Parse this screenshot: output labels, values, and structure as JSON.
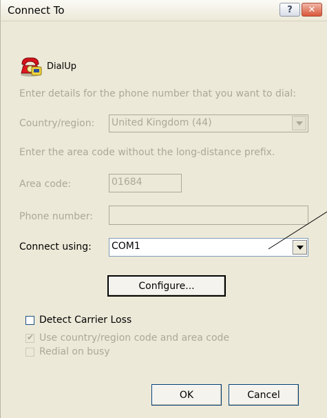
{
  "window": {
    "title": "Connect To",
    "help_glyph": "?",
    "close_glyph": "✕"
  },
  "connection": {
    "name": "DialUp",
    "icon": "phone-icon"
  },
  "instructions": {
    "phone": "Enter details for the phone number that you want to dial:",
    "area": "Enter the area code without the long-distance prefix."
  },
  "form": {
    "country_label": "Country/region:",
    "country_value": "United Kingdom (44)",
    "area_label": "Area code:",
    "area_value": "01684",
    "phone_label": "Phone number:",
    "phone_value": "",
    "connect_label": "Connect using:",
    "connect_value": "COM1"
  },
  "buttons": {
    "configure": "Configure...",
    "ok": "OK",
    "cancel": "Cancel"
  },
  "checkboxes": {
    "detect_carrier": {
      "label": "Detect Carrier Loss",
      "checked": false,
      "enabled": true
    },
    "use_country": {
      "label": "Use country/region code and area code",
      "checked": true,
      "enabled": false
    },
    "redial": {
      "label": "Redial on busy",
      "checked": false,
      "enabled": false
    }
  },
  "colors": {
    "dialog_bg": "#ece9d8",
    "disabled_text": "#aca899",
    "field_border": "#7f9db9"
  }
}
